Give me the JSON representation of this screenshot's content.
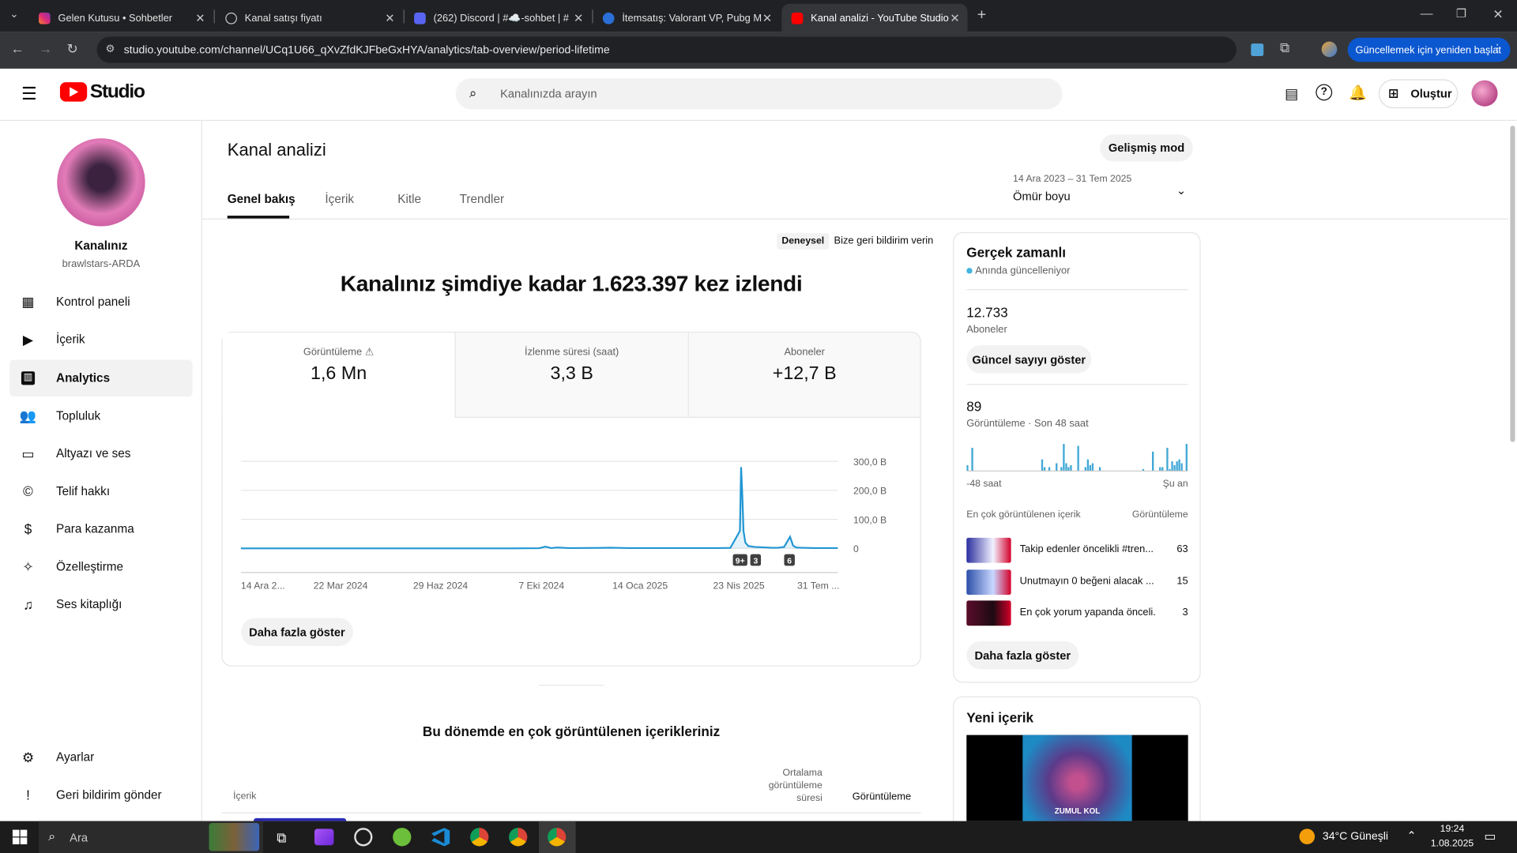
{
  "browser": {
    "tabs": [
      {
        "title": "Gelen Kutusu • Sohbetler"
      },
      {
        "title": "Kanal satışı fiyatı"
      },
      {
        "title": "(262) Discord | #☁️-sohbet | #"
      },
      {
        "title": "İtemsatış: Valorant VP, Pubg M"
      },
      {
        "title": "Kanal analizi - YouTube Studio"
      }
    ],
    "url": "studio.youtube.com/channel/UCq1U66_qXvZfdKJFbeGxHYA/analytics/tab-overview/period-lifetime",
    "update_label": "Güncellemek için yeniden başlat"
  },
  "header": {
    "logo_text": "Studio",
    "search_placeholder": "Kanalınızda arayın",
    "create_label": "Oluştur"
  },
  "sidebar": {
    "channel_title": "Kanalınız",
    "channel_handle": "brawlstars-ARDA",
    "items": [
      {
        "label": "Kontrol paneli",
        "icon": "dashboard-icon"
      },
      {
        "label": "İçerik",
        "icon": "content-icon"
      },
      {
        "label": "Analytics",
        "icon": "analytics-icon"
      },
      {
        "label": "Topluluk",
        "icon": "community-icon"
      },
      {
        "label": "Altyazı ve ses",
        "icon": "subtitles-icon"
      },
      {
        "label": "Telif hakkı",
        "icon": "copyright-icon"
      },
      {
        "label": "Para kazanma",
        "icon": "dollar-icon"
      },
      {
        "label": "Özelleştirme",
        "icon": "magic-wand-icon"
      },
      {
        "label": "Ses kitaplığı",
        "icon": "audio-library-icon"
      }
    ],
    "settings_label": "Ayarlar",
    "feedback_label": "Geri bildirim gönder"
  },
  "page": {
    "title": "Kanal analizi",
    "advanced_mode": "Gelişmiş mod",
    "tabs": [
      "Genel bakış",
      "İçerik",
      "Kitle",
      "Trendler"
    ],
    "date_range": "14 Ara 2023 – 31 Tem 2025",
    "period": "Ömür boyu",
    "badge": "Deneysel",
    "feedback_link": "Bize geri bildirim verin",
    "headline": "Kanalınız şimdiye kadar 1.623.397 kez izlendi",
    "stats": [
      {
        "label": "Görüntüleme",
        "value": "1,6 Mn"
      },
      {
        "label": "İzlenme süresi (saat)",
        "value": "3,3 B"
      },
      {
        "label": "Aboneler",
        "value": "+12,7 B"
      }
    ],
    "show_more": "Daha fazla göster",
    "top_content_title": "Bu dönemde en çok görüntülenen içerikleriniz",
    "table_headers": {
      "content": "İçerik",
      "avg_duration": "Ortalama görüntüleme süresi",
      "views": "Görüntüleme"
    }
  },
  "chart_data": {
    "type": "line",
    "x_tick_labels": [
      "14 Ara 2...",
      "22 Mar 2024",
      "29 Haz 2024",
      "7 Eki 2024",
      "14 Oca 2025",
      "23 Nis 2025",
      "31 Tem ..."
    ],
    "y_tick_labels": [
      "300,0 B",
      "200,0 B",
      "100,0 B",
      "0"
    ],
    "ylim": [
      0,
      300000
    ],
    "series": [
      {
        "x_frac": [
          0,
          0.05,
          0.1,
          0.15,
          0.2,
          0.25,
          0.3,
          0.35,
          0.4,
          0.45,
          0.5,
          0.51,
          0.52,
          0.53,
          0.55,
          0.6,
          0.62,
          0.65,
          0.7,
          0.75,
          0.8,
          0.82,
          0.836,
          0.838,
          0.84,
          0.842,
          0.845,
          0.85,
          0.86,
          0.87,
          0.88,
          0.89,
          0.9,
          0.91,
          0.92,
          0.925,
          0.93,
          0.94,
          0.95,
          0.96,
          0.98,
          1.0
        ],
        "values": [
          0,
          0,
          0,
          0,
          0,
          0,
          0,
          0,
          0,
          0,
          500,
          6000,
          1000,
          3000,
          1000,
          1500,
          2500,
          1000,
          1000,
          1000,
          1000,
          1500,
          60000,
          280000,
          180000,
          60000,
          20000,
          8000,
          5000,
          4000,
          3000,
          2000,
          2000,
          5000,
          40000,
          10000,
          3000,
          2000,
          1500,
          1000,
          1000,
          1000
        ]
      }
    ],
    "annotations": [
      "9+",
      "3",
      "6"
    ],
    "grid": true
  },
  "realtime": {
    "title": "Gerçek zamanlı",
    "status": "Anında güncelleniyor",
    "subscribers_value": "12.733",
    "subscribers_label": "Aboneler",
    "show_live_count": "Güncel sayıyı göster",
    "views_value": "89",
    "views_label": "Görüntüleme · Son 48 saat",
    "bars_48h": [
      3,
      0,
      12,
      0,
      0,
      0,
      0,
      0,
      0,
      0,
      0,
      0,
      0,
      0,
      0,
      0,
      0,
      0,
      0,
      0,
      0,
      0,
      0,
      0,
      0,
      0,
      0,
      0,
      0,
      0,
      0,
      6,
      2,
      0,
      2,
      0,
      0,
      4,
      0,
      2,
      14,
      4,
      2,
      3,
      0,
      0,
      13,
      0,
      0,
      2,
      6,
      3,
      4,
      0,
      0,
      2,
      0,
      0,
      0,
      0,
      0,
      0,
      0,
      0,
      0,
      0,
      0,
      0,
      0,
      0,
      0,
      0,
      0,
      1,
      0,
      0,
      0,
      10,
      0,
      0,
      2,
      2,
      0,
      12,
      1,
      5,
      3,
      5,
      6,
      4,
      0,
      14
    ],
    "axis_left": "-48 saat",
    "axis_right": "Şu an",
    "top_header": "En çok görüntülenen içerik",
    "top_views_header": "Görüntüleme",
    "top_items": [
      {
        "title": "Takip edenler öncelikli #tren...",
        "views": "63"
      },
      {
        "title": "Unutmayın 0 beğeni alacak ...",
        "views": "15"
      },
      {
        "title": "En çok yorum yapanda önceli...",
        "views": "3"
      }
    ],
    "show_more": "Daha fazla göster"
  },
  "new_content": {
    "title": "Yeni içerik",
    "thumb_text": "ZUMUL KOL"
  },
  "taskbar": {
    "search": "Ara",
    "weather": "34°C  Güneşli",
    "time": "19:24",
    "date": "1.08.2025"
  },
  "colors": {
    "accent": "#065fd4",
    "chart_line": "#2196d3",
    "youtube_red": "#ff0000"
  }
}
